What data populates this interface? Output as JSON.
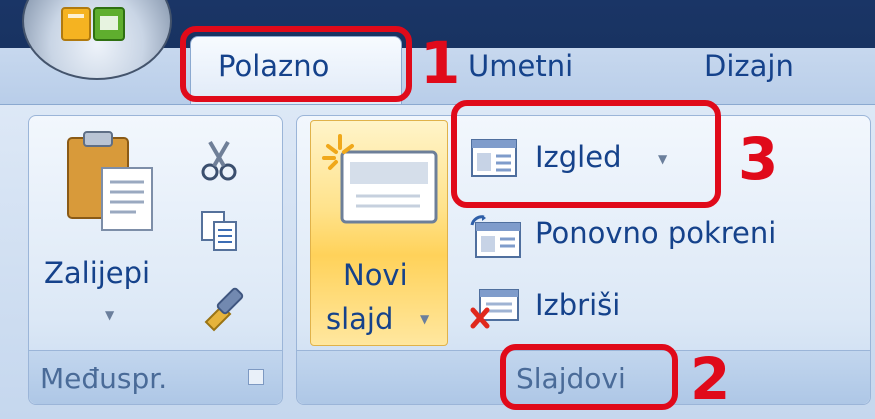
{
  "ribbon": {
    "tabs": [
      {
        "label": "Polazno",
        "active": true
      },
      {
        "label": "Umetni",
        "active": false
      },
      {
        "label": "Dizajn",
        "active": false
      }
    ],
    "groups": {
      "clipboard": {
        "footer": "Međuspr.",
        "paste_label": "Zalijepi"
      },
      "slides": {
        "footer": "Slajdovi",
        "new_slide_line1": "Novi",
        "new_slide_line2": "slajd",
        "layout_label": "Izgled",
        "reset_label": "Ponovno pokreni",
        "delete_label": "Izbriši"
      }
    }
  },
  "annotations": {
    "tab_marker": "1",
    "group_marker": "2",
    "layout_marker": "3",
    "color": "#e00a1a"
  },
  "icons": [
    "office-button-icon",
    "paste-icon",
    "cut-icon",
    "copy-icon",
    "format-painter-icon",
    "new-slide-icon",
    "layout-icon",
    "reset-icon",
    "delete-slide-icon",
    "dialog-launcher-icon"
  ]
}
